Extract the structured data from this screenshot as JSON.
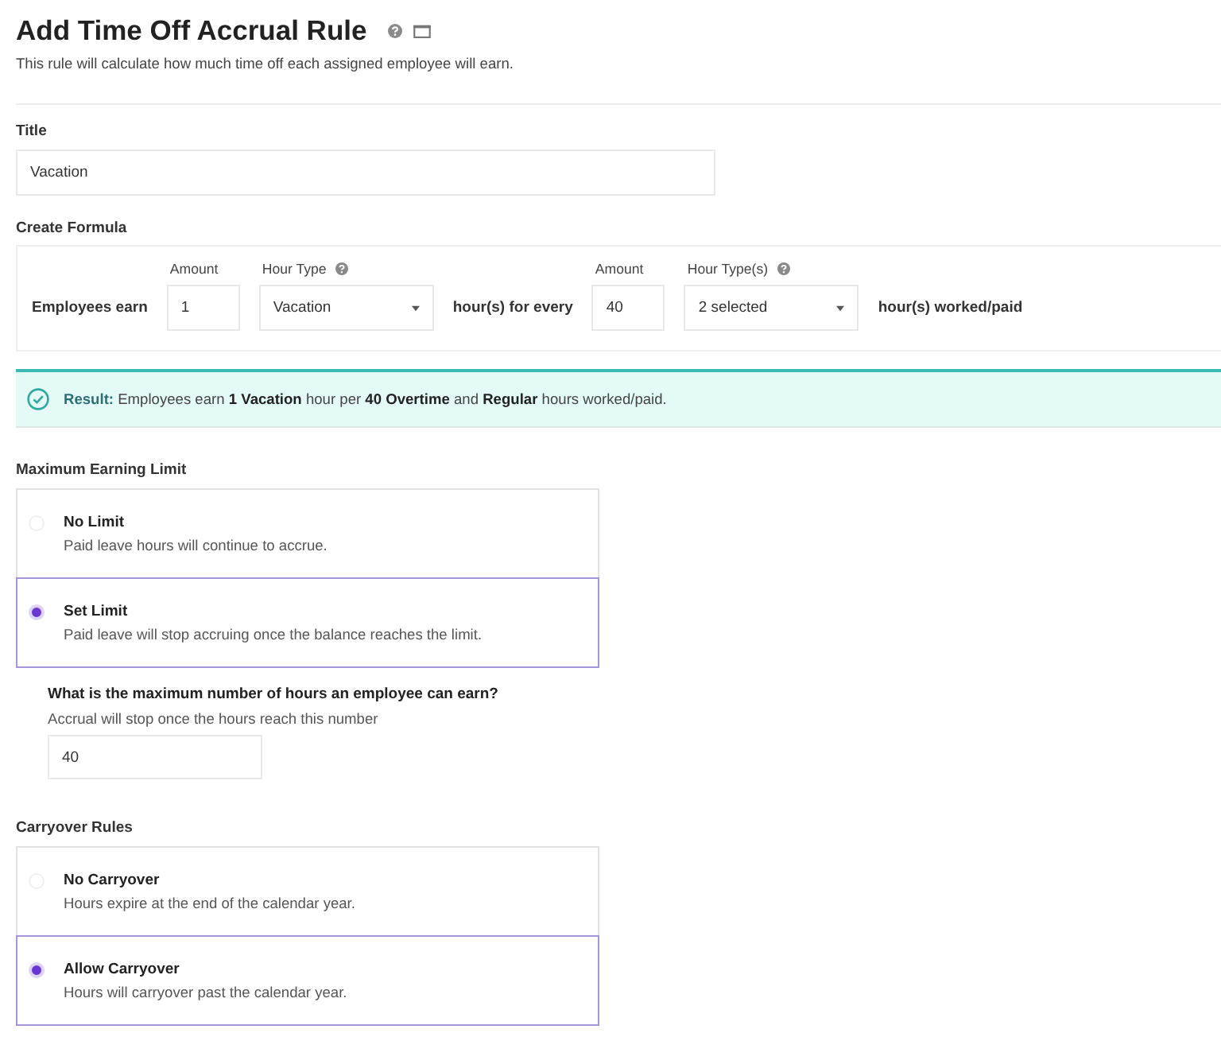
{
  "header": {
    "title": "Add Time Off Accrual Rule",
    "subtitle": "This rule will calculate how much time off each assigned employee will earn."
  },
  "title_field": {
    "label": "Title",
    "value": "Vacation"
  },
  "formula": {
    "label": "Create Formula",
    "items": [
      {
        "kind": "text",
        "text": "Employees earn"
      },
      {
        "kind": "input",
        "label": "Amount",
        "value": "1"
      },
      {
        "kind": "select",
        "label": "Hour Type",
        "help": true,
        "value": "Vacation"
      },
      {
        "kind": "text",
        "text": "hour(s) for every"
      },
      {
        "kind": "input",
        "label": "Amount",
        "value": "40"
      },
      {
        "kind": "select",
        "label": "Hour Type(s)",
        "help": true,
        "value": "2 selected"
      },
      {
        "kind": "text",
        "text": "hour(s) worked/paid"
      }
    ]
  },
  "result": {
    "text": "**Result:** Employees earn **1 Vacation** hour per **40 Overtime** and **Regular** hours worked/paid."
  },
  "earning_limit": {
    "label": "Maximum Earning Limit",
    "options": [
      {
        "title": "No Limit",
        "description": "Paid leave hours will continue to accrue.",
        "selected": false
      },
      {
        "title": "Set Limit",
        "description": "Paid leave will stop accruing once the balance reaches the limit.",
        "selected": true
      }
    ],
    "follow_up": {
      "question": "What is the maximum number of hours an employee can earn?",
      "hint": "Accrual will stop once the hours reach this number",
      "value": "40"
    }
  },
  "carryover": {
    "label": "Carryover Rules",
    "options": [
      {
        "title": "No Carryover",
        "description": "Hours expire at the end of the calendar year.",
        "selected": false
      },
      {
        "title": "Allow Carryover",
        "description": "Hours will carryover past the calendar year.",
        "selected": true
      }
    ]
  }
}
